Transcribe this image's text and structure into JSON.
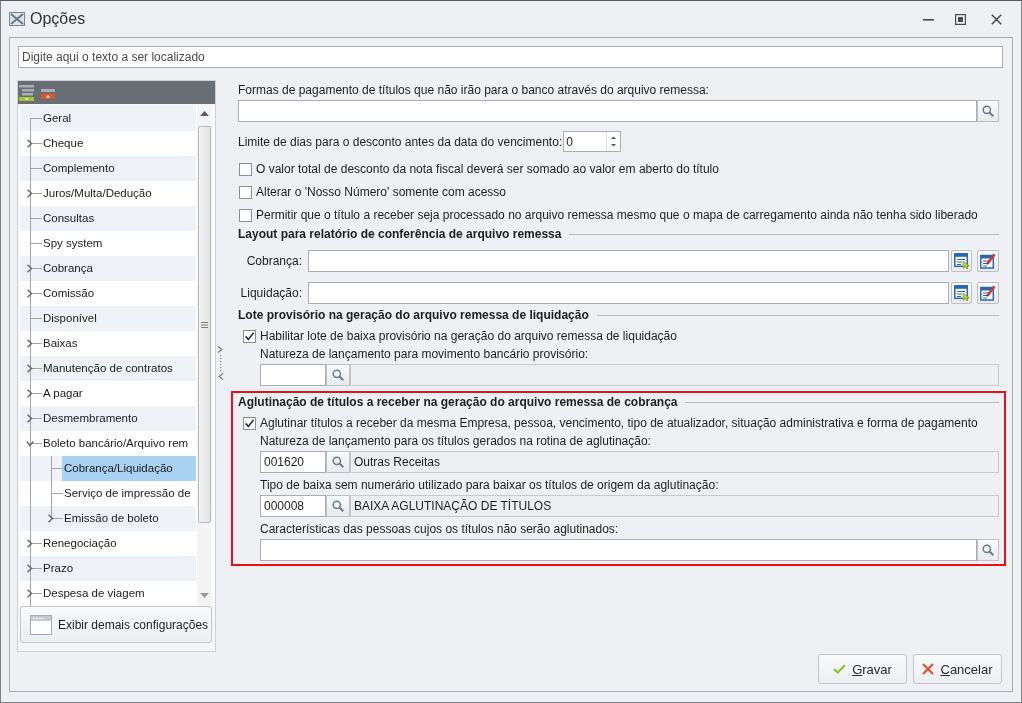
{
  "window": {
    "title": "Opções"
  },
  "search": {
    "placeholder": "Digite aqui o texto a ser localizado"
  },
  "tree": {
    "items": [
      {
        "label": "Geral",
        "kind": "leaf",
        "selected": false
      },
      {
        "label": "Cheque",
        "kind": "group",
        "expanded": false,
        "selected": false
      },
      {
        "label": "Complemento",
        "kind": "leaf",
        "selected": false
      },
      {
        "label": "Juros/Multa/Dedução",
        "kind": "group",
        "expanded": false,
        "selected": false
      },
      {
        "label": "Consultas",
        "kind": "leaf",
        "selected": false
      },
      {
        "label": "Spy system",
        "kind": "leaf",
        "selected": false
      },
      {
        "label": "Cobrança",
        "kind": "group",
        "expanded": false,
        "selected": false
      },
      {
        "label": "Comissão",
        "kind": "group",
        "expanded": false,
        "selected": false
      },
      {
        "label": "Disponível",
        "kind": "leaf",
        "selected": false
      },
      {
        "label": "Baixas",
        "kind": "group",
        "expanded": false,
        "selected": false
      },
      {
        "label": "Manutenção de contratos",
        "kind": "group",
        "expanded": false,
        "selected": false
      },
      {
        "label": "A pagar",
        "kind": "group",
        "expanded": false,
        "selected": false
      },
      {
        "label": "Desmembramento",
        "kind": "group",
        "expanded": false,
        "selected": false
      },
      {
        "label": "Boleto bancário/Arquivo rem",
        "kind": "group",
        "expanded": true,
        "selected": false,
        "children": [
          {
            "label": "Cobrança/Liquidação",
            "kind": "leaf",
            "selected": true
          },
          {
            "label": "Serviço de impressão de",
            "kind": "leaf",
            "selected": false
          },
          {
            "label": "Emissão de boleto",
            "kind": "group",
            "expanded": false,
            "selected": false
          }
        ]
      },
      {
        "label": "Renegociação",
        "kind": "group",
        "expanded": false,
        "selected": false
      },
      {
        "label": "Prazo",
        "kind": "group",
        "expanded": false,
        "selected": false
      },
      {
        "label": "Despesa de viagem",
        "kind": "group",
        "expanded": false,
        "selected": false
      }
    ],
    "footer_button": {
      "label": "Exibir demais configurações"
    }
  },
  "sections": [
    {
      "rows": [
        {
          "kind": "search_field",
          "label": "Formas de pagamento de títulos que não irão para o banco através do arquivo remessa:"
        },
        {
          "kind": "spinner",
          "label": "Limite de dias para o desconto antes da data do vencimento:",
          "value": "0"
        },
        {
          "kind": "checkbox",
          "label": "O valor total de desconto da nota fiscal deverá ser somado ao valor em aberto do título",
          "checked": false
        },
        {
          "kind": "checkbox",
          "label": "Alterar o 'Nosso Número' somente com acesso",
          "checked": false
        },
        {
          "kind": "checkbox",
          "label": "Permitir que o título a receber seja processado no arquivo remessa mesmo que o mapa de carregamento ainda não tenha sido liberado",
          "checked": false
        }
      ]
    },
    {
      "title": "Layout para relatório de conferência de arquivo remessa",
      "rows": [
        {
          "kind": "report_field",
          "label": "Cobrança:"
        },
        {
          "kind": "report_field",
          "label": "Liquidação:"
        }
      ]
    },
    {
      "title": "Lote provisório na geração do arquivo remessa de liquidação",
      "rows": [
        {
          "kind": "checkbox",
          "label": "Habilitar lote de baixa provisório na geração do arquivo remessa de liquidação",
          "checked": true,
          "children": [
            {
              "kind": "code_lookup",
              "label": "Natureza de lançamento para movimento bancário provisório:"
            }
          ]
        }
      ]
    },
    {
      "title": "Aglutinação de títulos a receber na geração do arquivo remessa de cobrança",
      "highlighted": true,
      "rows": [
        {
          "kind": "checkbox",
          "label": "Aglutinar títulos a receber da mesma Empresa, pessoa, vencimento, tipo de atualizador, situação administrativa e forma de pagamento",
          "checked": true,
          "children": [
            {
              "kind": "code_lookup",
              "label": "Natureza de lançamento para os títulos gerados na rotina de aglutinação:",
              "code": "001620",
              "description": "Outras Receitas"
            },
            {
              "kind": "code_lookup",
              "label": "Tipo de baixa sem numerário utilizado para baixar os títulos de origem da aglutinação:",
              "code": "000008",
              "description": "BAIXA AGLUTINAÇÃO DE TÍTULOS"
            },
            {
              "kind": "search_field",
              "label": "Características das pessoas cujos os títulos não serão aglutinados:"
            }
          ]
        }
      ]
    }
  ],
  "buttons": [
    {
      "label": "Gravar",
      "kind": "confirm"
    },
    {
      "label": "Cancelar",
      "kind": "cancel"
    }
  ]
}
